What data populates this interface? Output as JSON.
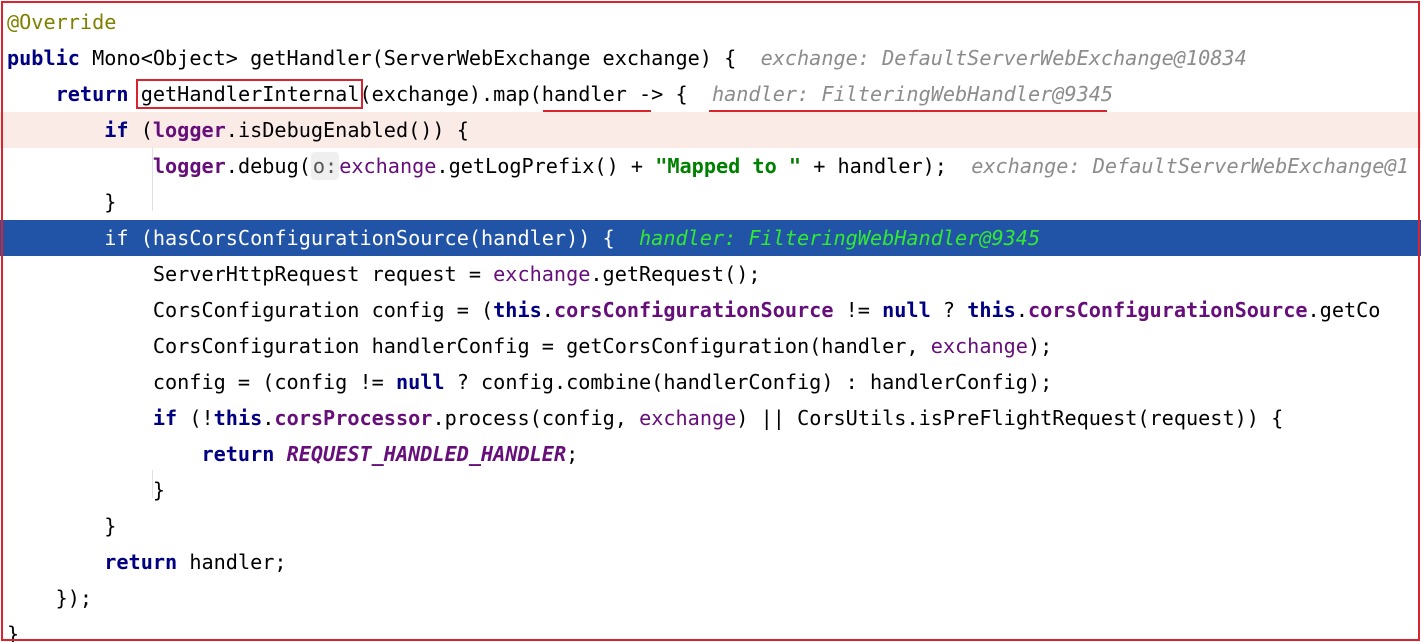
{
  "lines": [
    [
      {
        "c": "ann",
        "t": "@Override"
      }
    ],
    [
      {
        "c": "kw",
        "t": "public"
      },
      {
        "c": "pl",
        "t": " Mono<Object> getHandler(ServerWebExchange exchange) {  "
      },
      {
        "c": "hint",
        "t": "exchange: DefaultServerWebExchange@10834"
      }
    ],
    [
      {
        "c": "pl",
        "t": "    "
      },
      {
        "c": "kw",
        "t": "return"
      },
      {
        "c": "pl",
        "t": " getHandlerInternal(exchange).map(handler -> {  "
      },
      {
        "c": "hint",
        "t": "handler: FilteringWebHandler@9345"
      }
    ],
    [
      {
        "c": "pl",
        "t": "        "
      },
      {
        "c": "kw",
        "t": "if"
      },
      {
        "c": "pl",
        "t": " ("
      },
      {
        "c": "fld",
        "t": "logger"
      },
      {
        "c": "pl",
        "t": ".isDebugEnabled()) {"
      }
    ],
    [
      {
        "c": "pl",
        "t": "            "
      },
      {
        "c": "fld",
        "t": "logger"
      },
      {
        "c": "pl",
        "t": ".debug("
      },
      {
        "c": "phint",
        "t": "o:"
      },
      {
        "c": "par",
        "t": "exchange"
      },
      {
        "c": "pl",
        "t": ".getLogPrefix() + "
      },
      {
        "c": "str",
        "t": "\"Mapped to \""
      },
      {
        "c": "pl",
        "t": " + handler);  "
      },
      {
        "c": "hint",
        "t": "exchange: DefaultServerWebExchange@1"
      }
    ],
    [
      {
        "c": "pl",
        "t": "        }"
      }
    ],
    [
      {
        "c": "pl",
        "t": "        "
      },
      {
        "c": "kw",
        "t": "if"
      },
      {
        "c": "pl",
        "t": " (hasCorsConfigurationSource(handler)) {  "
      },
      {
        "c": "hint-sel",
        "t": "handler: FilteringWebHandler@9345"
      }
    ],
    [
      {
        "c": "pl",
        "t": "            ServerHttpRequest request = "
      },
      {
        "c": "par",
        "t": "exchange"
      },
      {
        "c": "pl",
        "t": ".getRequest();"
      }
    ],
    [
      {
        "c": "pl",
        "t": "            CorsConfiguration config = ("
      },
      {
        "c": "kw",
        "t": "this"
      },
      {
        "c": "pl",
        "t": "."
      },
      {
        "c": "fld",
        "t": "corsConfigurationSource"
      },
      {
        "c": "pl",
        "t": " != "
      },
      {
        "c": "kw",
        "t": "null"
      },
      {
        "c": "pl",
        "t": " ? "
      },
      {
        "c": "kw",
        "t": "this"
      },
      {
        "c": "pl",
        "t": "."
      },
      {
        "c": "fld",
        "t": "corsConfigurationSource"
      },
      {
        "c": "pl",
        "t": ".getCo"
      }
    ],
    [
      {
        "c": "pl",
        "t": "            CorsConfiguration handlerConfig = getCorsConfiguration(handler, "
      },
      {
        "c": "par",
        "t": "exchange"
      },
      {
        "c": "pl",
        "t": ");"
      }
    ],
    [
      {
        "c": "pl",
        "t": "            config = (config != "
      },
      {
        "c": "kw",
        "t": "null"
      },
      {
        "c": "pl",
        "t": " ? config.combine(handlerConfig) : handlerConfig);"
      }
    ],
    [
      {
        "c": "pl",
        "t": "            "
      },
      {
        "c": "kw",
        "t": "if"
      },
      {
        "c": "pl",
        "t": " (!"
      },
      {
        "c": "kw",
        "t": "this"
      },
      {
        "c": "pl",
        "t": "."
      },
      {
        "c": "fld",
        "t": "corsProcessor"
      },
      {
        "c": "pl",
        "t": ".process(config, "
      },
      {
        "c": "par",
        "t": "exchange"
      },
      {
        "c": "pl",
        "t": ") || CorsUtils.isPreFlightRequest(request)) {"
      }
    ],
    [
      {
        "c": "pl",
        "t": "                "
      },
      {
        "c": "kw",
        "t": "return"
      },
      {
        "c": "pl",
        "t": " "
      },
      {
        "c": "cst",
        "t": "REQUEST_HANDLED_HANDLER"
      },
      {
        "c": "pl",
        "t": ";"
      }
    ],
    [
      {
        "c": "pl",
        "t": "            }"
      }
    ],
    [
      {
        "c": "pl",
        "t": "        }"
      }
    ],
    [
      {
        "c": "pl",
        "t": "        "
      },
      {
        "c": "kw",
        "t": "return"
      },
      {
        "c": "pl",
        "t": " handler;"
      }
    ],
    [
      {
        "c": "pl",
        "t": "    });"
      }
    ],
    [
      {
        "c": "pl",
        "t": "}"
      }
    ]
  ],
  "colors": {
    "execution_line": "#2154a6",
    "breakpoint_line": "#faebe7",
    "annotation_red": "#d9232e",
    "keyword": "#000080",
    "field": "#660e7a",
    "string": "#008000",
    "inline_hint": "#8c8c8c",
    "inline_hint_selected": "#33e833",
    "annotation": "#808000"
  },
  "states": {
    "highlighted_line": "if (hasCorsConfigurationSource(handler)) {",
    "breakpoint_line": "if (logger.isDebugEnabled()) {"
  }
}
